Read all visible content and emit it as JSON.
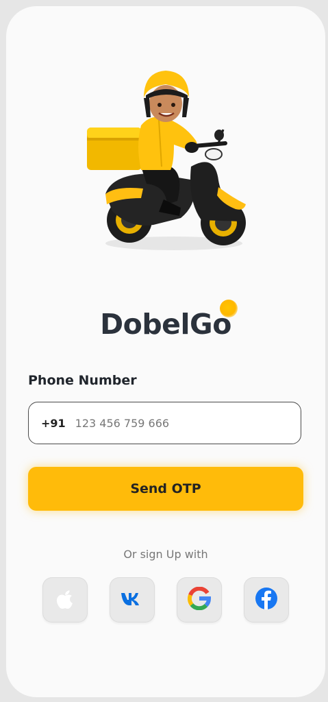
{
  "brand": {
    "name": "DobelGo"
  },
  "form": {
    "phone_label": "Phone Number",
    "country_code": "+91",
    "phone_placeholder": "123 456 759 666",
    "send_label": "Send OTP"
  },
  "social": {
    "prompt": "Or sign Up with",
    "icons": [
      "apple-icon",
      "vk-icon",
      "google-icon",
      "facebook-icon"
    ]
  },
  "colors": {
    "accent": "#ffbb0a",
    "text_dark": "#2b323c",
    "background": "#fafafa"
  }
}
